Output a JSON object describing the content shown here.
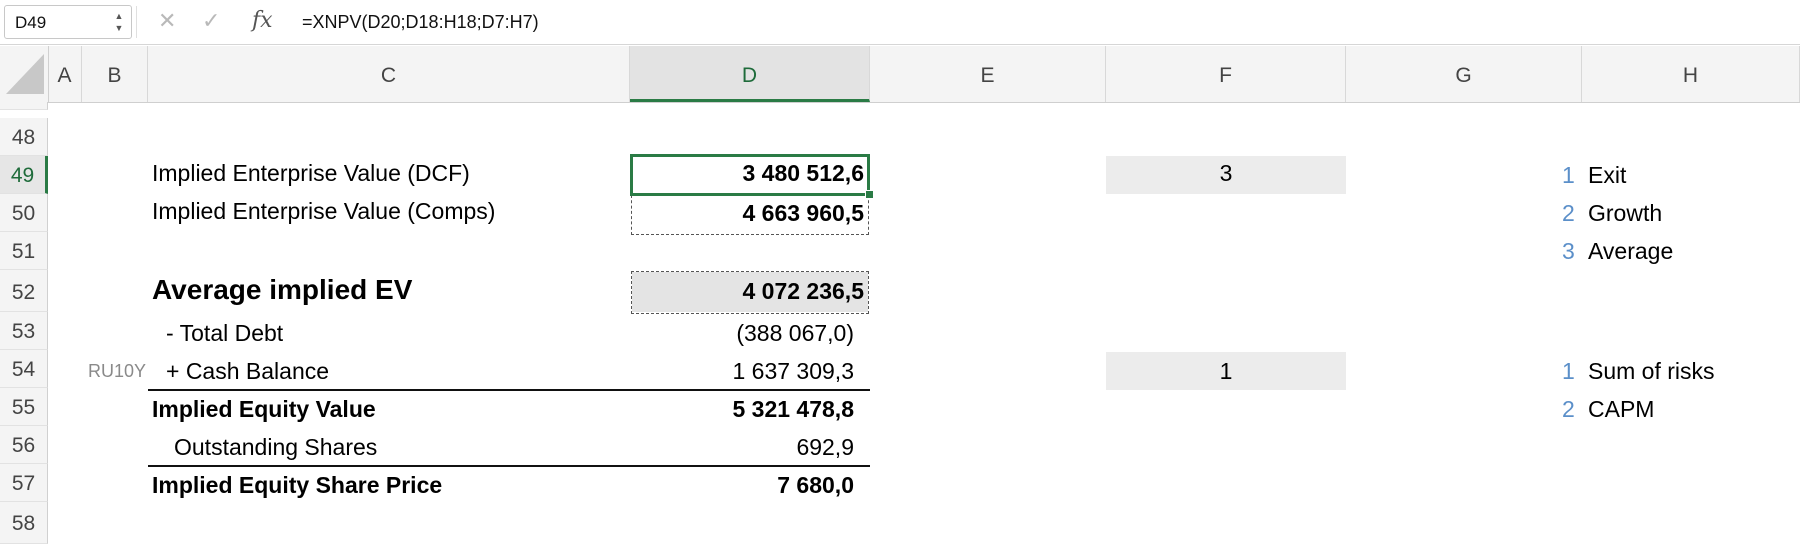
{
  "formula_bar": {
    "name_box": "D49",
    "stepper_up": "▲",
    "stepper_down": "▼",
    "cancel_icon": "✕",
    "enter_icon": "✓",
    "fx_label": "fx",
    "formula": "=XNPV(D20;D18:H18;D7:H7)"
  },
  "columns": [
    "A",
    "B",
    "C",
    "D",
    "E",
    "F",
    "G",
    "H"
  ],
  "rows": [
    "48",
    "49",
    "50",
    "51",
    "52",
    "53",
    "54",
    "55",
    "56",
    "57",
    "58"
  ],
  "cells": {
    "c49": "Implied Enterprise Value (DCF)",
    "d49": "3 480 512,6",
    "f49": "3",
    "c50": "Implied Enterprise Value (Comps)",
    "d50": "4 663 960,5",
    "c52": "Average implied EV",
    "d52": "4 072 236,5",
    "c53": "- Total Debt",
    "d53": "(388 067,0)",
    "b54": "RU10Y",
    "c54": "+ Cash Balance",
    "d54": "1 637 309,3",
    "f54": "1",
    "c55": "Implied Equity Value",
    "d55": "5 321 478,8",
    "c56": "Outstanding Shares",
    "d56": "692,9",
    "c57": "Implied Equity Share Price",
    "d57": "7 680,0"
  },
  "options_ev": [
    {
      "num": "1",
      "label": "Exit"
    },
    {
      "num": "2",
      "label": "Growth"
    },
    {
      "num": "3",
      "label": "Average"
    }
  ],
  "options_risk": [
    {
      "num": "1",
      "label": "Sum of risks"
    },
    {
      "num": "2",
      "label": "CAPM"
    }
  ],
  "colors": {
    "selection_green": "#2a7b45",
    "option_number_blue": "#5b8fc9",
    "shade_grey": "#ececec"
  }
}
